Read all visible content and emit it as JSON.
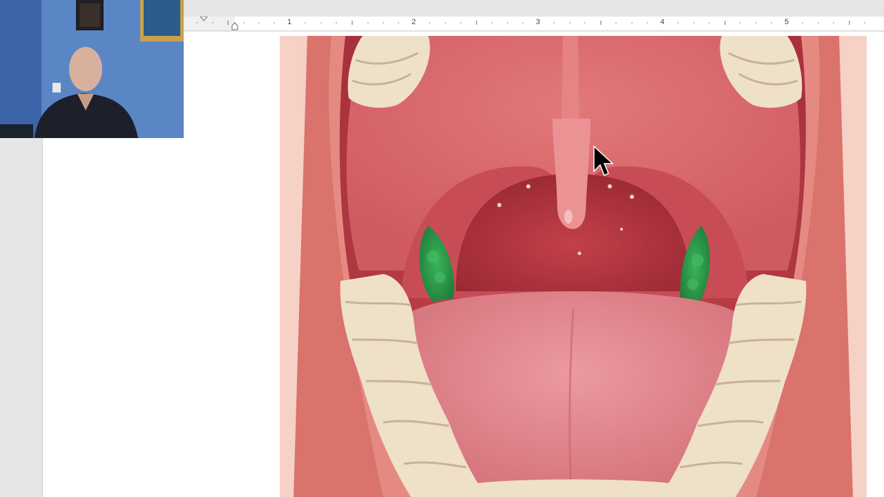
{
  "ruler": {
    "numbers": [
      "1",
      "2",
      "3",
      "4",
      "5"
    ]
  },
  "figure": {
    "subject": "open-mouth-anatomy-illustration",
    "highlight_color": "#2e9a48"
  },
  "webcam": {
    "subject": "presenter-video"
  },
  "colors": {
    "page": "#ffffff",
    "workspace": "#e6e6e6",
    "lip": "#d9736c",
    "palate": "#d65a5e",
    "tongue": "#e07f86",
    "tooth": "#efe0c8"
  }
}
